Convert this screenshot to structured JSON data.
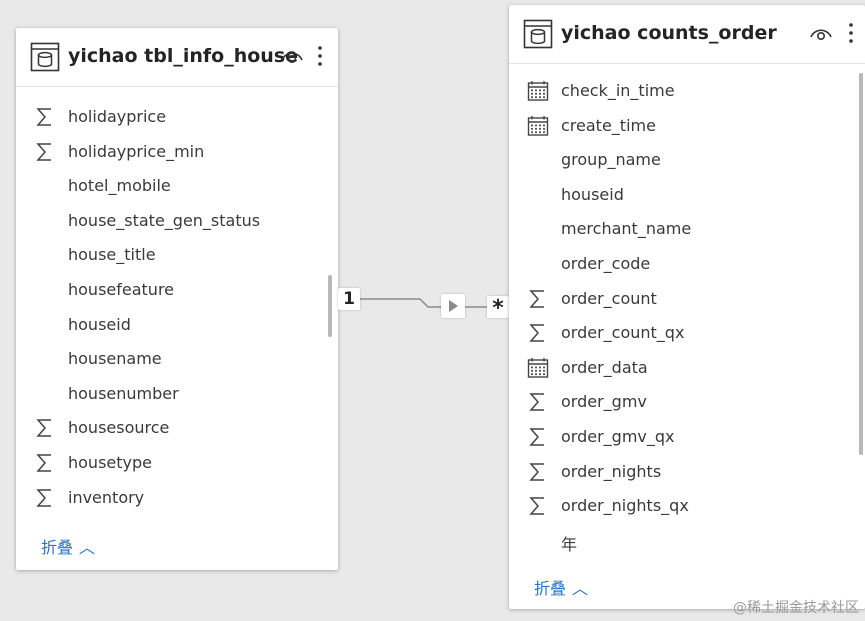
{
  "left_table": {
    "title": "yichao tbl_info_house",
    "collapse_label": "折叠",
    "fields": [
      {
        "name": "holidayprice",
        "type": "sum-icon"
      },
      {
        "name": "holidayprice_min",
        "type": "sum-icon"
      },
      {
        "name": "hotel_mobile",
        "type": "none"
      },
      {
        "name": "house_state_gen_status",
        "type": "none"
      },
      {
        "name": "house_title",
        "type": "none"
      },
      {
        "name": "housefeature",
        "type": "none"
      },
      {
        "name": "houseid",
        "type": "none"
      },
      {
        "name": "housename",
        "type": "none"
      },
      {
        "name": "housenumber",
        "type": "none"
      },
      {
        "name": "housesource",
        "type": "sum-icon"
      },
      {
        "name": "housetype",
        "type": "sum-icon"
      },
      {
        "name": "inventory",
        "type": "sum-icon"
      }
    ]
  },
  "right_table": {
    "title": "yichao counts_order",
    "collapse_label": "折叠",
    "fields": [
      {
        "name": "check_in_time",
        "type": "calendar-icon"
      },
      {
        "name": "create_time",
        "type": "calendar-icon"
      },
      {
        "name": "group_name",
        "type": "none"
      },
      {
        "name": "houseid",
        "type": "none"
      },
      {
        "name": "merchant_name",
        "type": "none"
      },
      {
        "name": "order_code",
        "type": "none"
      },
      {
        "name": "order_count",
        "type": "sum-icon"
      },
      {
        "name": "order_count_qx",
        "type": "sum-icon"
      },
      {
        "name": "order_data",
        "type": "calendar-icon"
      },
      {
        "name": "order_gmv",
        "type": "sum-icon"
      },
      {
        "name": "order_gmv_qx",
        "type": "sum-icon"
      },
      {
        "name": "order_nights",
        "type": "sum-icon"
      },
      {
        "name": "order_nights_qx",
        "type": "sum-icon"
      },
      {
        "name": "年",
        "type": "none"
      }
    ]
  },
  "relationship": {
    "from_cardinality": "1",
    "to_cardinality": "*",
    "direction": "single"
  },
  "watermark": "@稀土掘金技术社区",
  "colors": {
    "canvas": "#e9e9e9",
    "card": "#ffffff",
    "title": "#252423",
    "field_text": "#3b3a39",
    "link": "#2a73c9",
    "connector": "#8a8a8a"
  }
}
